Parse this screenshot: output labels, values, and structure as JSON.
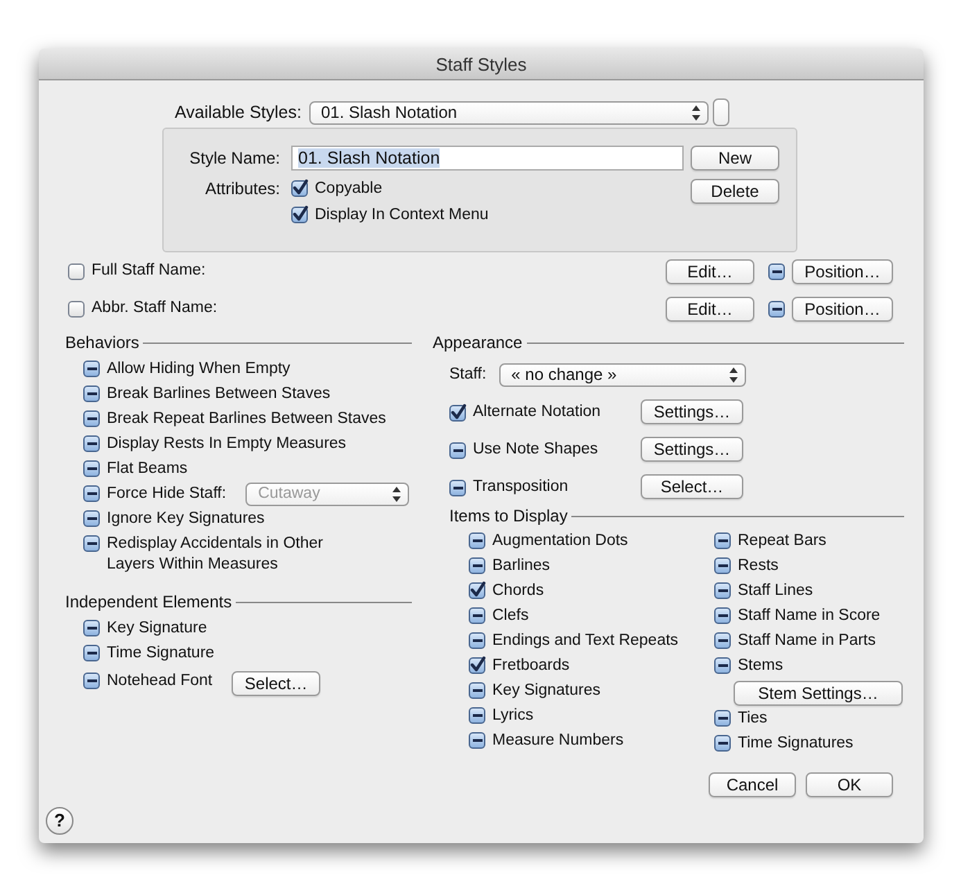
{
  "window": {
    "title": "Staff Styles"
  },
  "available_styles": {
    "label": "Available Styles:",
    "value": "01.  Slash Notation"
  },
  "style_box": {
    "name_label": "Style Name:",
    "name_value": "01.  Slash Notation",
    "attributes_label": "Attributes:",
    "attributes": [
      {
        "label": "Copyable",
        "checked": true,
        "mixed": false
      },
      {
        "label": "Display In Context Menu",
        "checked": true,
        "mixed": false
      }
    ],
    "buttons": [
      "New",
      "Delete"
    ]
  },
  "staff_names": [
    {
      "label": "Full Staff Name:",
      "checked": false,
      "mixed": false,
      "edit": "Edit…",
      "position_checked": true,
      "position_mixed": true,
      "position": "Position…"
    },
    {
      "label": "Abbr. Staff Name:",
      "checked": false,
      "mixed": false,
      "edit": "Edit…",
      "position_checked": true,
      "position_mixed": true,
      "position": "Position…"
    }
  ],
  "behaviors": {
    "title": "Behaviors",
    "items": [
      {
        "kind": "check",
        "label": "Allow Hiding When Empty",
        "checked": true,
        "mixed": true
      },
      {
        "kind": "check",
        "label": "Break Barlines Between Staves",
        "checked": true,
        "mixed": true
      },
      {
        "kind": "check",
        "label": "Break Repeat Barlines Between Staves",
        "checked": true,
        "mixed": true
      },
      {
        "kind": "check",
        "label": "Display Rests In Empty Measures",
        "checked": true,
        "mixed": true
      },
      {
        "kind": "check",
        "label": "Flat Beams",
        "checked": true,
        "mixed": true
      },
      {
        "kind": "popup",
        "label": "Force Hide Staff:",
        "checked": true,
        "mixed": true,
        "popup": "Cutaway",
        "disabled": true
      },
      {
        "kind": "check",
        "label": "Ignore Key Signatures",
        "checked": true,
        "mixed": true
      },
      {
        "kind": "check",
        "label": "Redisplay Accidentals in Other Layers Within Measures",
        "checked": true,
        "mixed": true
      }
    ]
  },
  "independent": {
    "title": "Independent Elements",
    "items": [
      {
        "kind": "check",
        "label": "Key Signature",
        "checked": true,
        "mixed": true
      },
      {
        "kind": "check",
        "label": "Time Signature",
        "checked": true,
        "mixed": true
      },
      {
        "kind": "button",
        "label": "Notehead Font",
        "checked": true,
        "mixed": true,
        "button": "Select…"
      }
    ]
  },
  "appearance": {
    "title": "Appearance",
    "staff_label": "Staff:",
    "staff_value": "« no change »",
    "items": [
      {
        "label": "Alternate Notation",
        "checked": true,
        "mixed": false,
        "button": "Settings…"
      },
      {
        "label": "Use Note Shapes",
        "checked": true,
        "mixed": true,
        "button": "Settings…"
      },
      {
        "label": "Transposition",
        "checked": true,
        "mixed": true,
        "button": "Select…"
      }
    ]
  },
  "items_to_display": {
    "title": "Items to Display",
    "columns": [
      [
        {
          "kind": "check",
          "label": "Augmentation Dots",
          "checked": true,
          "mixed": true
        },
        {
          "kind": "check",
          "label": "Barlines",
          "checked": true,
          "mixed": true
        },
        {
          "kind": "check",
          "label": "Chords",
          "checked": true,
          "mixed": false
        },
        {
          "kind": "check",
          "label": "Clefs",
          "checked": true,
          "mixed": true
        },
        {
          "kind": "check",
          "label": "Endings and Text Repeats",
          "checked": true,
          "mixed": true
        },
        {
          "kind": "check",
          "label": "Fretboards",
          "checked": true,
          "mixed": false
        },
        {
          "kind": "check",
          "label": "Key Signatures",
          "checked": true,
          "mixed": true
        },
        {
          "kind": "check",
          "label": "Lyrics",
          "checked": true,
          "mixed": true
        },
        {
          "kind": "check",
          "label": "Measure Numbers",
          "checked": true,
          "mixed": true
        }
      ],
      [
        {
          "kind": "check",
          "label": "Repeat Bars",
          "checked": true,
          "mixed": true
        },
        {
          "kind": "check",
          "label": "Rests",
          "checked": true,
          "mixed": true
        },
        {
          "kind": "check",
          "label": "Staff Lines",
          "checked": true,
          "mixed": true
        },
        {
          "kind": "check",
          "label": "Staff Name in Score",
          "checked": true,
          "mixed": true
        },
        {
          "kind": "check",
          "label": "Staff Name in Parts",
          "checked": true,
          "mixed": true
        },
        {
          "kind": "check",
          "label": "Stems",
          "checked": true,
          "mixed": true
        },
        {
          "kind": "button",
          "button": "Stem Settings…"
        },
        {
          "kind": "check",
          "label": "Ties",
          "checked": true,
          "mixed": true
        },
        {
          "kind": "check",
          "label": "Time Signatures",
          "checked": true,
          "mixed": true
        }
      ]
    ]
  },
  "footer": {
    "help": "?",
    "buttons": [
      "Cancel",
      "OK"
    ]
  }
}
